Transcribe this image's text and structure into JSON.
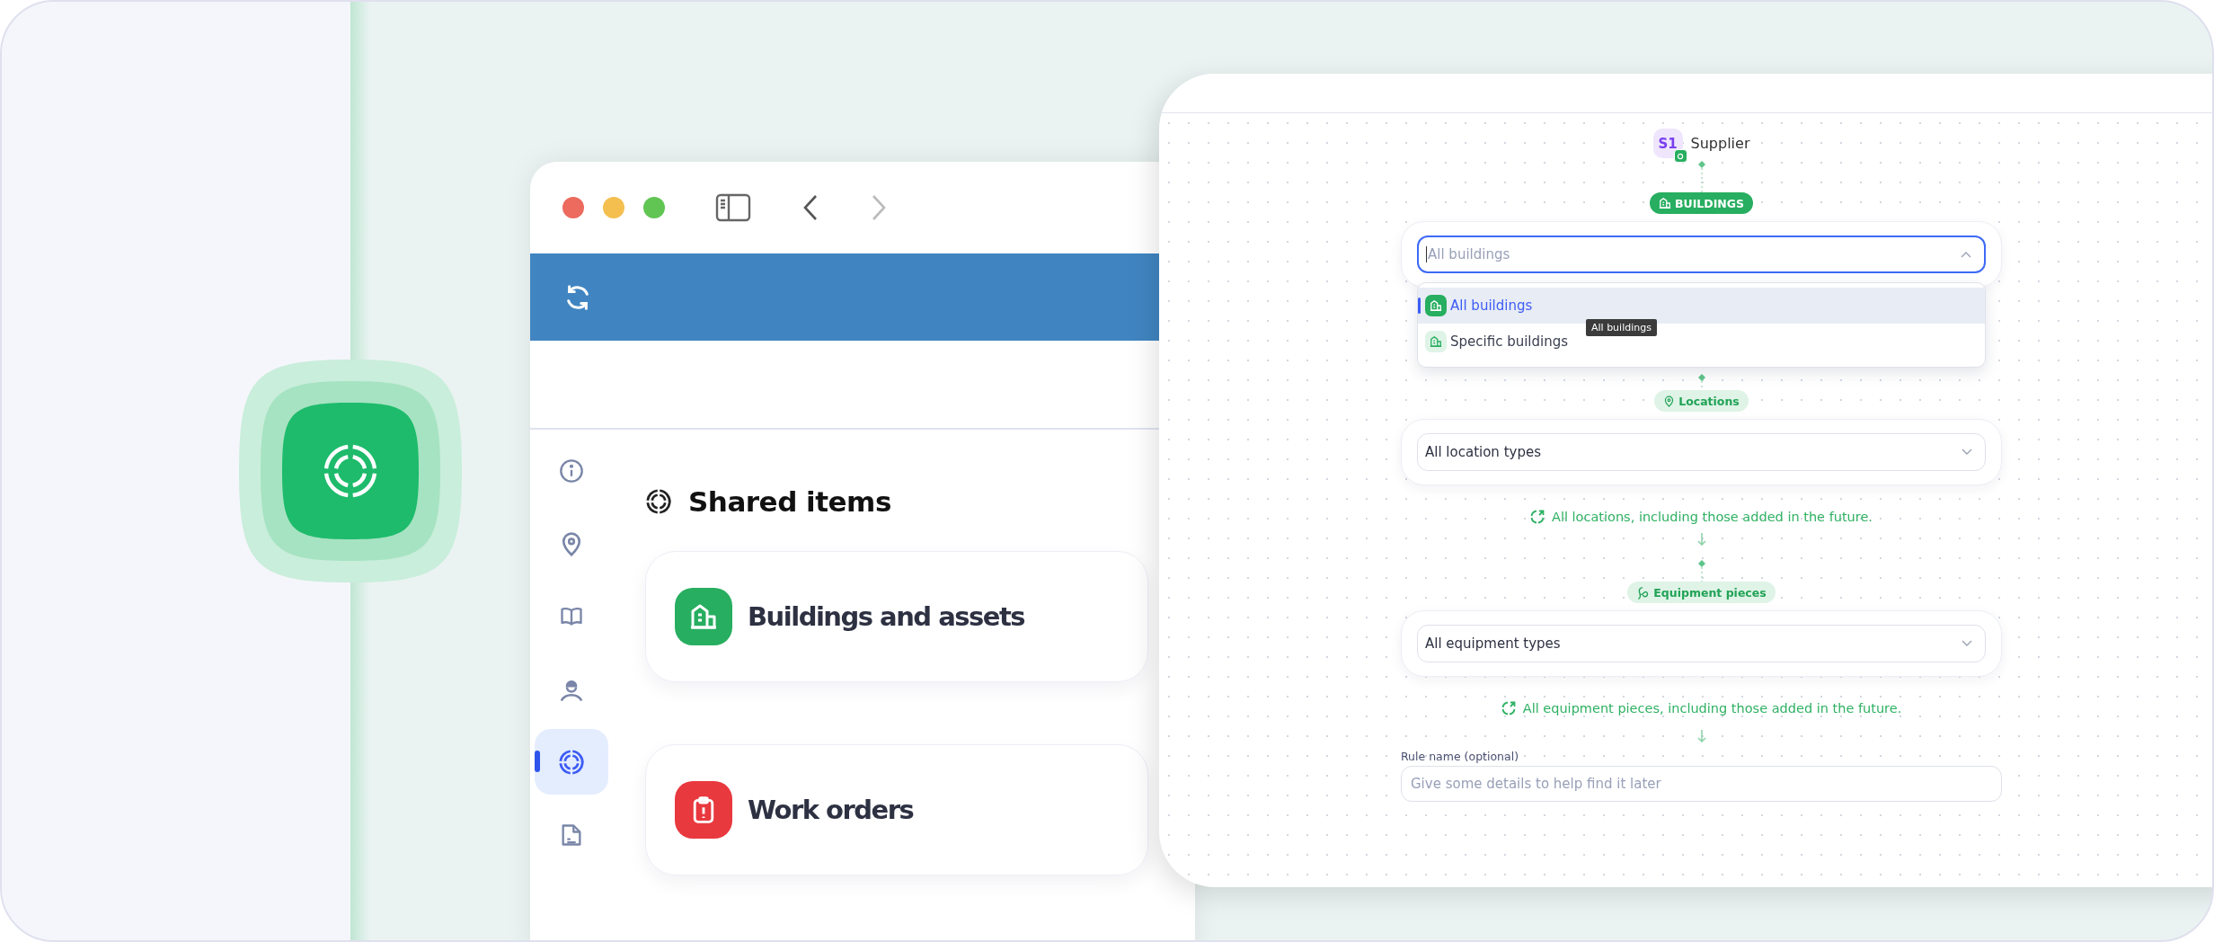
{
  "left_window": {
    "heading": "Shared items",
    "sidebar": [
      {
        "kind": "info",
        "selected": false
      },
      {
        "kind": "location",
        "selected": false
      },
      {
        "kind": "book",
        "selected": false
      },
      {
        "kind": "worker",
        "selected": false
      },
      {
        "kind": "shared",
        "selected": true
      },
      {
        "kind": "report",
        "selected": false
      }
    ],
    "cards": [
      {
        "kind": "buildings",
        "title": "Buildings and assets",
        "color": "#27ae60"
      },
      {
        "kind": "workorders",
        "title": "Work orders",
        "color": "#e8393f"
      }
    ]
  },
  "rule_editor": {
    "source": {
      "initials": "S1",
      "name": "Supplier"
    },
    "sections": [
      {
        "pill": {
          "kind": "buildings",
          "label": "BUILDINGS",
          "active": true
        },
        "select": {
          "placeholder": "All buildings",
          "expanded": true
        },
        "options": [
          {
            "label": "All buildings",
            "selected": true
          },
          {
            "label": "Specific buildings",
            "selected": false
          }
        ],
        "tooltip": "All buildings"
      },
      {
        "pill": {
          "kind": "location",
          "label": "Locations",
          "active": false
        },
        "select": {
          "value": "All location types",
          "expanded": false
        },
        "note": "All locations, including those added in the future."
      },
      {
        "pill": {
          "kind": "equipment",
          "label": "Equipment pieces",
          "active": false
        },
        "select": {
          "value": "All equipment types",
          "expanded": false
        },
        "note": "All equipment pieces, including those added in the future."
      }
    ],
    "rule_name": {
      "label": "Rule name (optional)",
      "placeholder": "Give some details to help find it later"
    }
  }
}
